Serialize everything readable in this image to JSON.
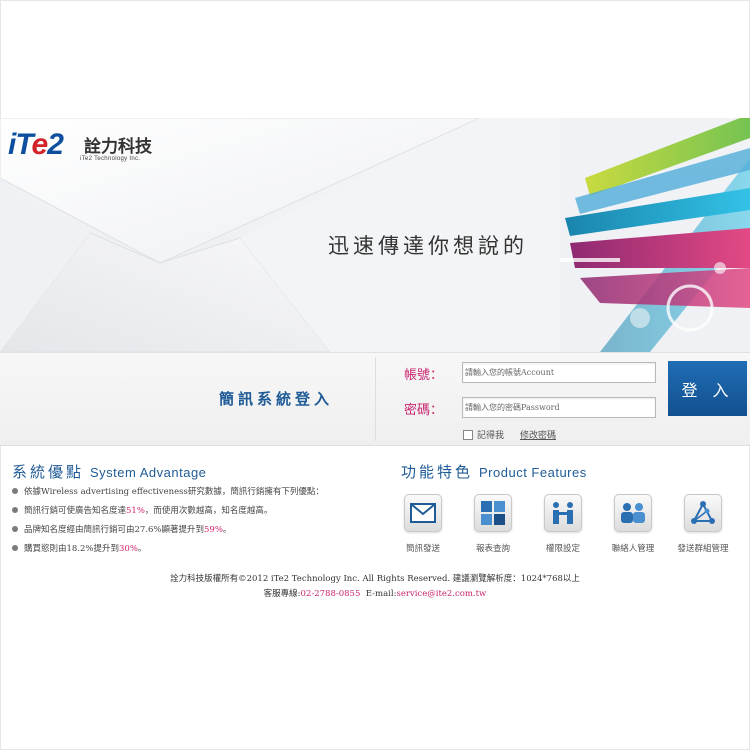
{
  "header": {
    "logo_mark": "iTe2",
    "logo_cn": "詮力科技",
    "logo_en": "iTe2 Technology Inc.",
    "slogan": "迅速傳達你想說的"
  },
  "login": {
    "title": "簡訊系統登入",
    "account_label": "帳號：",
    "account_placeholder": "請輸入您的帳號Account",
    "password_label": "密碼：",
    "password_placeholder": "請輸入您的密碼Password",
    "button_label": "登 入",
    "remember_label": "記得我",
    "change_password_label": "修改密碼"
  },
  "advantages": {
    "title_cn": "系統優點",
    "title_en": "System Advantage",
    "items": [
      {
        "text": "依據Wireless advertising effectiveness研究數據，簡訊行銷擁有下列優點：",
        "highlight": "",
        "suffix": ""
      },
      {
        "text": "簡訊行銷可使廣告知名度達",
        "highlight": "51%",
        "suffix": "，而使用次數越高，知名度越高。"
      },
      {
        "text": "品牌知名度經由簡訊行銷可由27.6%顯著提升到",
        "highlight": "59%",
        "suffix": "。"
      },
      {
        "text": "購買慾則由18.2%提升到",
        "highlight": "30%",
        "suffix": "。"
      }
    ]
  },
  "features": {
    "title_cn": "功能特色",
    "title_en": "Product Features",
    "items": [
      {
        "label": "簡訊發送",
        "icon": "envelope-icon"
      },
      {
        "label": "報表查詢",
        "icon": "report-grid-icon"
      },
      {
        "label": "權限設定",
        "icon": "permission-icon"
      },
      {
        "label": "聯絡人管理",
        "icon": "contacts-icon"
      },
      {
        "label": "發送群組管理",
        "icon": "group-network-icon"
      }
    ]
  },
  "footer": {
    "copyright": "詮力科技版權所有©2012 iTe2 Technology Inc. All Rights Reserved. 建議瀏覽解析度：1024*768以上",
    "hotline_label": "客服專線:",
    "hotline": "02-2788-0855",
    "email_label": "E-mail:",
    "email": "service@ite2.com.tw"
  },
  "colors": {
    "brand_blue": "#1f5b96",
    "accent_pink": "#c8246f",
    "button_blue": "#1a63a8"
  }
}
